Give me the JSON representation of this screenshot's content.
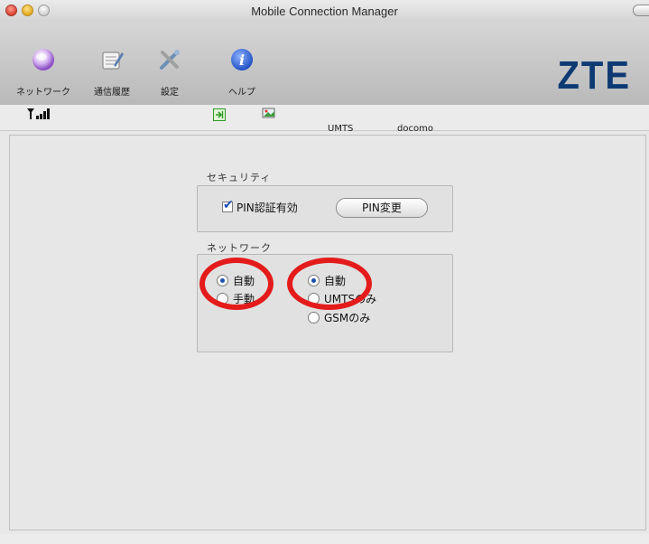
{
  "window": {
    "title": "Mobile Connection Manager"
  },
  "toolbar": {
    "items": [
      {
        "label": "ネットワーク",
        "icon": "network-globe-icon"
      },
      {
        "label": "通信履歴",
        "icon": "history-notepad-icon"
      },
      {
        "label": "設定",
        "icon": "settings-tools-icon"
      },
      {
        "label": "ヘルプ",
        "icon": "help-info-icon"
      }
    ],
    "logo": "ZTE"
  },
  "status": {
    "signal_icon": "signal-strength-icon",
    "connect_icon": "connect-icon",
    "message_icon": "message-icon",
    "network_type": "UMTS",
    "operator": "docomo"
  },
  "security": {
    "group_label": "セキュリティ",
    "pin_checkbox_label": "PIN認証有効",
    "pin_checkbox_checked": true,
    "pin_change_button": "PIN変更"
  },
  "network": {
    "group_label": "ネットワーク",
    "mode_options": [
      {
        "label": "自動",
        "selected": true
      },
      {
        "label": "手動",
        "selected": false
      }
    ],
    "type_options": [
      {
        "label": "自動",
        "selected": true
      },
      {
        "label": "UMTSのみ",
        "selected": false
      },
      {
        "label": "GSMのみ",
        "selected": false
      }
    ]
  },
  "colors": {
    "annotation_circle": "#e41b1b",
    "logo": "#0d3a73",
    "radio_dot": "#1b4fb0"
  }
}
